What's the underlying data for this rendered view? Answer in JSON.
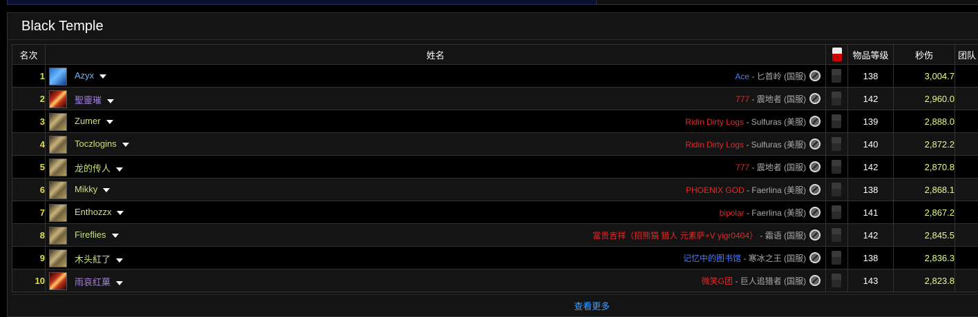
{
  "panel": {
    "title": "Black Temple",
    "more_label": "查看更多"
  },
  "headers": {
    "rank": "名次",
    "name": "姓名",
    "ilvl": "物品等级",
    "dps": "秒伤",
    "team": "团队"
  },
  "colors": {
    "rank_number": "#e0e040",
    "dps_value": "#e0ff80",
    "link_blue": "#3aa0ff"
  },
  "rows": [
    {
      "rank": "1",
      "name": "Azyx",
      "name_color": "#69b7ff",
      "avatar": "blue",
      "guild": "Ace",
      "guild_color": "#4a7bff",
      "realm": " - 匕首岭 (国服)",
      "ilvl": "138",
      "dps": "3,004.7"
    },
    {
      "rank": "2",
      "name": "聖靈璀",
      "name_color": "#a07fd6",
      "avatar": "fire",
      "guild": "777",
      "guild_color": "#e02a2a",
      "realm": " - 震地者 (国服)",
      "ilvl": "142",
      "dps": "2,960.0"
    },
    {
      "rank": "3",
      "name": "Zumer",
      "name_color": "#c8e07a",
      "avatar": "gold",
      "guild": "Ridin Dirty Logs",
      "guild_color": "#e02a2a",
      "realm": " - Sulfuras (美服)",
      "ilvl": "139",
      "dps": "2,888.0"
    },
    {
      "rank": "4",
      "name": "Toczlogins",
      "name_color": "#c8e07a",
      "avatar": "gold",
      "guild": "Ridin Dirty Logs",
      "guild_color": "#e02a2a",
      "realm": " - Sulfuras (美服)",
      "ilvl": "140",
      "dps": "2,872.2"
    },
    {
      "rank": "5",
      "name": "龙的传人",
      "name_color": "#c8e07a",
      "avatar": "gold",
      "guild": "777",
      "guild_color": "#e02a2a",
      "realm": " - 震地者 (国服)",
      "ilvl": "142",
      "dps": "2,870.8"
    },
    {
      "rank": "6",
      "name": "Mikky",
      "name_color": "#c8e07a",
      "avatar": "gold",
      "guild": "PHOENIX GOD",
      "guild_color": "#e02a2a",
      "realm": " - Faerlina (美服)",
      "ilvl": "138",
      "dps": "2,868.1"
    },
    {
      "rank": "7",
      "name": "Enthozzx",
      "name_color": "#c8e07a",
      "avatar": "gold",
      "guild": "bipolar",
      "guild_color": "#e02a2a",
      "realm": " - Faerlina (美服)",
      "ilvl": "141",
      "dps": "2,867.2"
    },
    {
      "rank": "8",
      "name": "Fireflies",
      "name_color": "#c8e07a",
      "avatar": "gold",
      "guild": "富贵吉祥（招熊猫 猎人 元素萨+V yigr0404）",
      "guild_color": "#e02a2a",
      "realm": " - 霜语 (国服)",
      "ilvl": "142",
      "dps": "2,845.5"
    },
    {
      "rank": "9",
      "name": "木头紅了",
      "name_color": "#c8e07a",
      "avatar": "gold",
      "guild": "记忆中的图书馆",
      "guild_color": "#4a7bff",
      "realm": " - 寒冰之王 (国服)",
      "ilvl": "138",
      "dps": "2,836.3"
    },
    {
      "rank": "10",
      "name": "雨哀红菓",
      "name_color": "#a07fd6",
      "avatar": "fire",
      "guild": "微笑G团",
      "guild_color": "#e02a2a",
      "realm": " - 巨人追猎者 (国服)",
      "ilvl": "143",
      "dps": "2,823.8"
    }
  ]
}
